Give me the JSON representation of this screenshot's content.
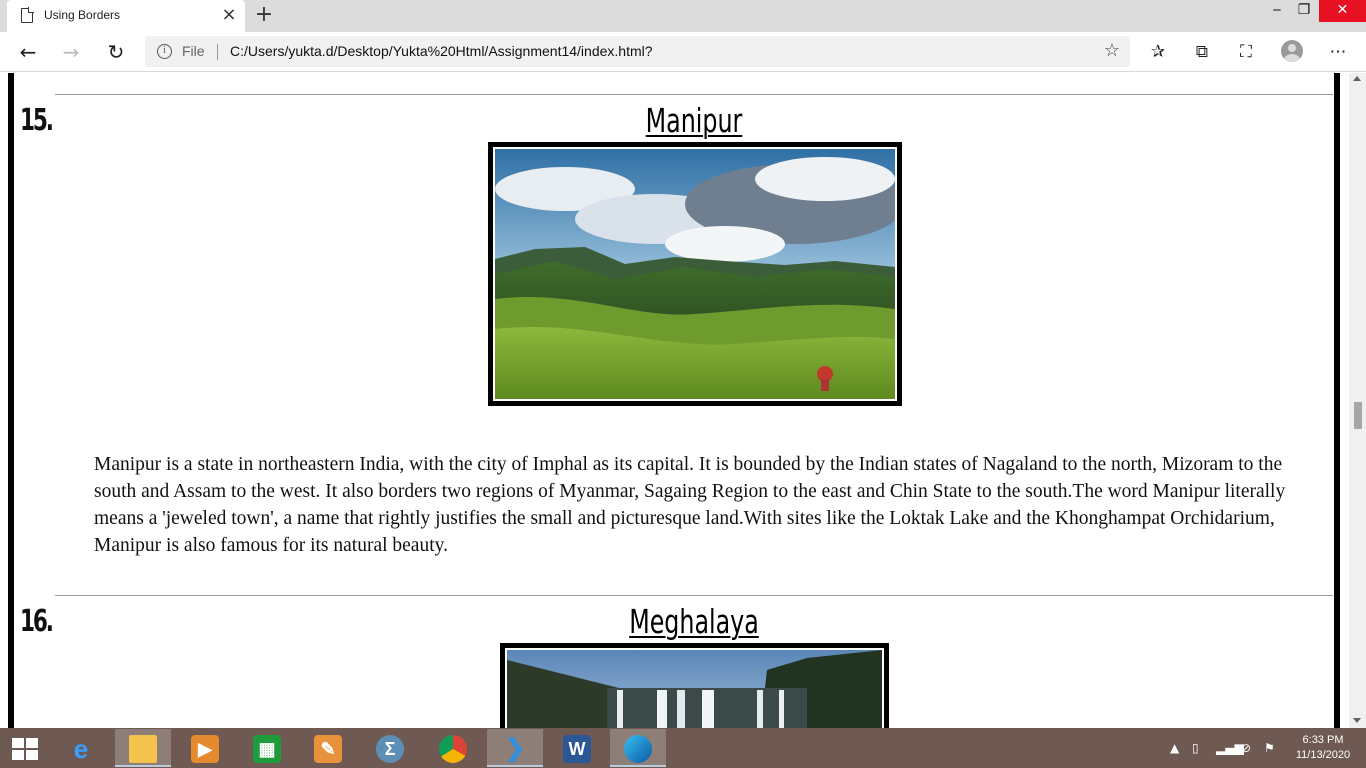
{
  "browser": {
    "tab_title": "Using Borders",
    "new_tab_symbol": "+",
    "address": {
      "scheme_label": "File",
      "url": "C:/Users/yukta.d/Desktop/Yukta%20Html/Assignment14/index.html?"
    },
    "window_controls": {
      "minimize": "‒",
      "maximize": "❐",
      "close": "✕"
    },
    "toolbar_icons": [
      "favorites-icon",
      "collections-icon",
      "read-aloud-icon",
      "profile-icon",
      "more-icon"
    ]
  },
  "page": {
    "sections": [
      {
        "number": "15.",
        "title": "Manipur",
        "image_alt": "Green hills under a cloudy blue sky with a hiker",
        "description": "Manipur is a state in northeastern India, with the city of Imphal as its capital. It is bounded by the Indian states of Nagaland to the north, Mizoram to the south and Assam to the west. It also borders two regions of Myanmar, Sagaing Region to the east and Chin State to the south.The word Manipur literally means a 'jeweled town', a name that rightly justifies the small and picturesque land.With sites like the Loktak Lake and the Khonghampat Orchidarium, Manipur is also famous for its natural beauty."
      },
      {
        "number": "16.",
        "title": "Meghalaya",
        "image_alt": "Waterfall cascading over a cliff surrounded by forest"
      }
    ]
  },
  "scrollbar": {
    "position_fraction": 0.51
  },
  "taskbar": {
    "apps": [
      "internet-explorer",
      "file-explorer",
      "media-player",
      "store",
      "paint",
      "math-input",
      "chrome",
      "visual-studio-code",
      "word",
      "edge"
    ],
    "time": "6:33 PM",
    "date": "11/13/2020"
  },
  "colors": {
    "close_button": "#e81123",
    "taskbar": "#6e5a52",
    "frame": "#000000"
  }
}
